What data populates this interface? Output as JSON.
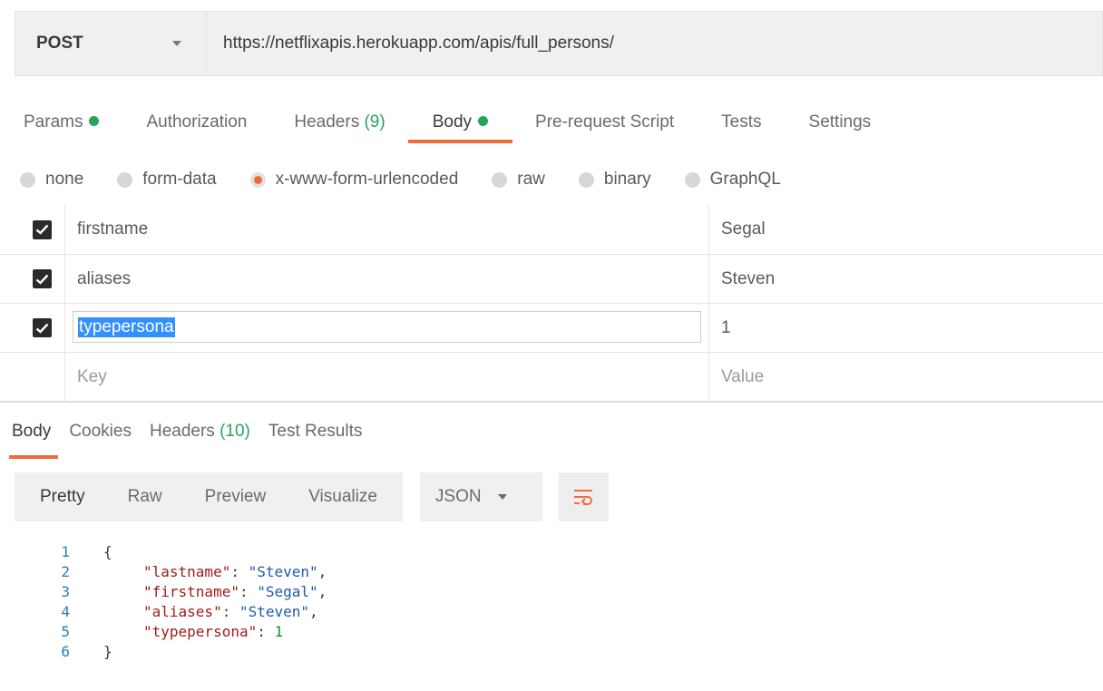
{
  "request": {
    "method": "POST",
    "url": "https://netflixapis.herokuapp.com/apis/full_persons/"
  },
  "request_tabs": [
    {
      "label": "Params",
      "dot": true
    },
    {
      "label": "Authorization"
    },
    {
      "label": "Headers",
      "count": "(9)"
    },
    {
      "label": "Body",
      "dot": true,
      "active": true
    },
    {
      "label": "Pre-request Script"
    },
    {
      "label": "Tests"
    },
    {
      "label": "Settings"
    }
  ],
  "body_types": [
    {
      "label": "none"
    },
    {
      "label": "form-data"
    },
    {
      "label": "x-www-form-urlencoded",
      "checked": true
    },
    {
      "label": "raw"
    },
    {
      "label": "binary"
    },
    {
      "label": "GraphQL"
    }
  ],
  "params": [
    {
      "key": "firstname",
      "value": "Segal",
      "checked": true
    },
    {
      "key": "aliases",
      "value": "Steven",
      "checked": true
    },
    {
      "key": "typepersona",
      "value": "1",
      "checked": true,
      "editing": true
    }
  ],
  "params_placeholder": {
    "key": "Key",
    "value": "Value"
  },
  "response_tabs": [
    {
      "label": "Body",
      "active": true
    },
    {
      "label": "Cookies"
    },
    {
      "label": "Headers",
      "count": "(10)"
    },
    {
      "label": "Test Results"
    }
  ],
  "view_modes": [
    "Pretty",
    "Raw",
    "Preview",
    "Visualize"
  ],
  "format": "JSON",
  "colors": {
    "accent": "#f26b3a",
    "green": "#26a55b"
  },
  "code": {
    "line_numbers": [
      "1",
      "2",
      "3",
      "4",
      "5",
      "6"
    ],
    "open_brace": "{",
    "close_brace": "}",
    "entries": [
      {
        "key": "\"lastname\"",
        "value": "\"Steven\"",
        "kind": "string",
        "comma": ","
      },
      {
        "key": "\"firstname\"",
        "value": "\"Segal\"",
        "kind": "string",
        "comma": ","
      },
      {
        "key": "\"aliases\"",
        "value": "\"Steven\"",
        "kind": "string",
        "comma": ","
      },
      {
        "key": "\"typepersona\"",
        "value": "1",
        "kind": "number",
        "comma": ""
      }
    ]
  }
}
